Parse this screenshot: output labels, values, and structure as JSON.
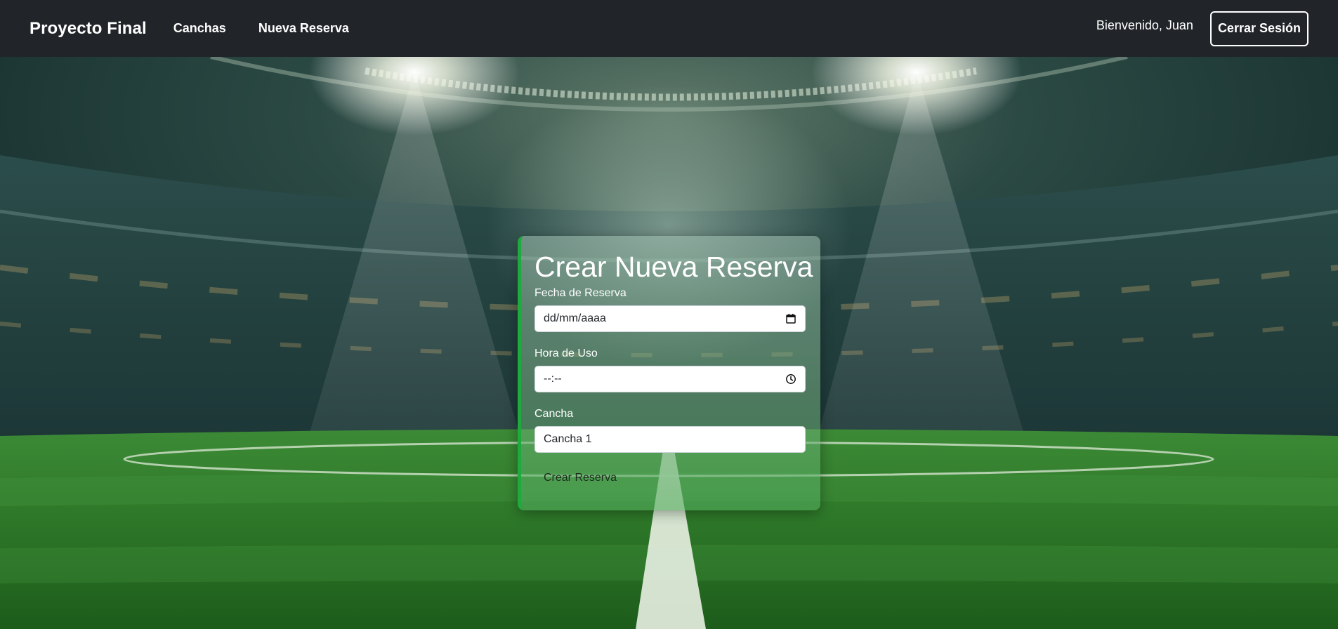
{
  "navbar": {
    "brand": "Proyecto Final",
    "links": [
      "Canchas",
      "Nueva Reserva"
    ],
    "welcome": "Bienvenido, Juan",
    "logout_label": "Cerrar Sesión"
  },
  "form": {
    "title": "Crear Nueva Reserva",
    "date_label": "Fecha de Reserva",
    "date_value": "dd/mm/aaaa",
    "time_label": "Hora de Uso",
    "time_value": "--:--",
    "court_label": "Cancha",
    "court_value": "Cancha 1",
    "submit_label": "Crear Reserva"
  },
  "icons": {
    "date": "calendar-icon",
    "time": "clock-icon"
  },
  "colors": {
    "navbar_bg": "#212529",
    "accent": "#1faa3e",
    "field_bg": "#ffffff"
  }
}
